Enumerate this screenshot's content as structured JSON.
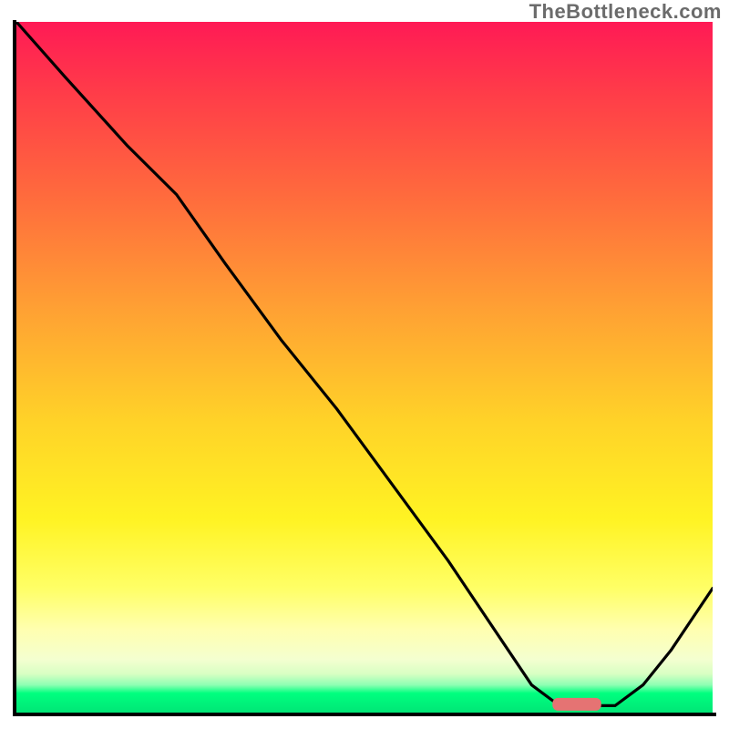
{
  "watermark": "TheBottleneck.com",
  "chart_data": {
    "type": "line",
    "title": "",
    "xlabel": "",
    "ylabel": "",
    "xlim": [
      0,
      100
    ],
    "ylim": [
      0,
      100
    ],
    "series": [
      {
        "name": "curve",
        "x": [
          0,
          7,
          16,
          23,
          30,
          38,
          46,
          54,
          62,
          70,
          74,
          78,
          82,
          86,
          90,
          94,
          100
        ],
        "y": [
          100,
          92,
          82,
          75,
          65,
          54,
          44,
          33,
          22,
          10,
          4,
          1,
          1,
          1,
          4,
          9,
          18
        ]
      }
    ],
    "marker": {
      "name": "optimal-range",
      "x_start": 77,
      "x_end": 84,
      "y": 1.2,
      "color": "#e57373"
    },
    "gradient_stops": [
      {
        "pos": 0.0,
        "color": "#ff1a55"
      },
      {
        "pos": 0.25,
        "color": "#ff6a3d"
      },
      {
        "pos": 0.58,
        "color": "#ffd328"
      },
      {
        "pos": 0.82,
        "color": "#ffff66"
      },
      {
        "pos": 0.95,
        "color": "#8dffb3"
      },
      {
        "pos": 1.0,
        "color": "#00e676"
      }
    ]
  }
}
